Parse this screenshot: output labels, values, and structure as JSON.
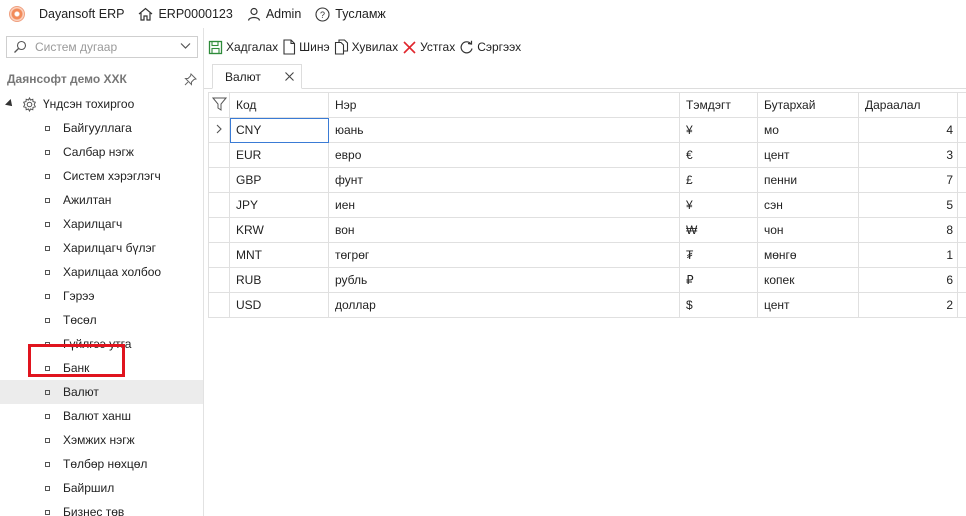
{
  "app": {
    "title": "Dayansoft ERP",
    "erp_code": "ERP0000123",
    "user": "Admin",
    "help": "Тусламж"
  },
  "sidebar": {
    "search_placeholder": "Систем дугаар",
    "company": "Даянсофт демо ХХК",
    "root": "Үндсэн тохиргоо",
    "items": [
      {
        "label": "Байгууллага"
      },
      {
        "label": "Салбар нэгж"
      },
      {
        "label": "Систем хэрэглэгч"
      },
      {
        "label": "Ажилтан"
      },
      {
        "label": "Харилцагч"
      },
      {
        "label": "Харилцагч бүлэг"
      },
      {
        "label": "Харилцаа холбоо"
      },
      {
        "label": "Гэрээ"
      },
      {
        "label": "Төсөл"
      },
      {
        "label": "Гүйлгээ утга"
      },
      {
        "label": "Банк"
      },
      {
        "label": "Валют"
      },
      {
        "label": "Валют ханш"
      },
      {
        "label": "Хэмжих нэгж"
      },
      {
        "label": "Төлбөр нөхцөл"
      },
      {
        "label": "Байршил"
      },
      {
        "label": "Бизнес төв"
      }
    ],
    "selected_index": 11
  },
  "toolbar": {
    "save": "Хадгалах",
    "new": "Шинэ",
    "copy": "Хувилах",
    "delete": "Устгах",
    "refresh": "Сэргээх"
  },
  "tab": {
    "label": "Валют"
  },
  "grid": {
    "columns": [
      "Код",
      "Нэр",
      "Тэмдэгт",
      "Бутархай",
      "Дараалал"
    ],
    "rows": [
      [
        "CNY",
        "юань",
        "¥",
        "мо",
        "4"
      ],
      [
        "EUR",
        "евро",
        "€",
        "цент",
        "3"
      ],
      [
        "GBP",
        "фунт",
        "£",
        "пенни",
        "7"
      ],
      [
        "JPY",
        "иен",
        "¥",
        "сэн",
        "5"
      ],
      [
        "KRW",
        "вон",
        "₩",
        "чон",
        "8"
      ],
      [
        "MNT",
        "төгрөг",
        "₮",
        "мөнгө",
        "1"
      ],
      [
        "RUB",
        "рубль",
        "₽",
        "копек",
        "6"
      ],
      [
        "USD",
        "доллар",
        "$",
        "цент",
        "2"
      ]
    ]
  }
}
